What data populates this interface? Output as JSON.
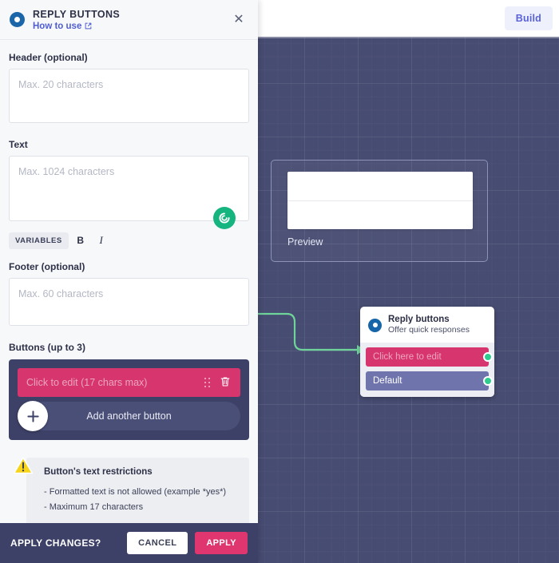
{
  "colors": {
    "accent_pink": "#d6356e",
    "panel_dark": "#3d4167",
    "canvas_bg": "#474c72",
    "connector_green": "#6fd49a",
    "port_green": "#2ecc8f",
    "link_blue": "#4f5dd1",
    "build_blue": "#5a63d8"
  },
  "canvas": {
    "build_label": "Build",
    "preview_node": {
      "label": "Preview"
    },
    "reply_node": {
      "icon": "reply-buttons-ring-icon",
      "title": "Reply buttons",
      "subtitle": "Offer quick responses",
      "chips": [
        {
          "label": "Click here to edit",
          "style": "pink"
        },
        {
          "label": "Default",
          "style": "purple"
        }
      ]
    }
  },
  "panel": {
    "icon": "reply-buttons-ring-icon",
    "title": "REPLY BUTTONS",
    "howto_label": "How to use",
    "howto_icon": "external-link-icon",
    "close_icon": "close-icon",
    "fields": {
      "header": {
        "label": "Header (optional)",
        "value": "",
        "placeholder": "Max. 20 characters"
      },
      "text": {
        "label": "Text",
        "value": "",
        "placeholder": "Max. 1024 characters",
        "badge_icon": "chat-widget-icon"
      },
      "footer": {
        "label": "Footer (optional)",
        "value": "",
        "placeholder": "Max. 60 characters"
      }
    },
    "format_bar": {
      "variables_label": "VARIABLES",
      "bold_label": "B",
      "italic_label": "I"
    },
    "buttons_section": {
      "label": "Buttons (up to 3)",
      "button_row_label": "Click to edit (17 chars max)",
      "drag_icon": "drag-handle-icon",
      "delete_icon": "trash-icon",
      "add_label": "Add another button",
      "add_icon": "plus-icon"
    },
    "warning": {
      "icon": "warning-triangle-icon",
      "title": "Button's text restrictions",
      "lines": [
        "- Formatted text is not allowed (example *yes*)",
        "- Maximum 17 characters"
      ]
    },
    "apply_bar": {
      "prompt": "APPLY CHANGES?",
      "cancel_label": "CANCEL",
      "apply_label": "APPLY"
    }
  }
}
